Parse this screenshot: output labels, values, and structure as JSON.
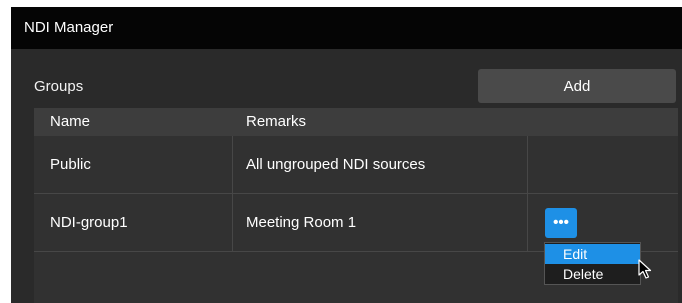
{
  "window": {
    "title": "NDI Manager"
  },
  "groups": {
    "label": "Groups",
    "add_label": "Add",
    "columns": {
      "name": "Name",
      "remarks": "Remarks"
    },
    "rows": [
      {
        "name": "Public",
        "remarks": "All ungrouped NDI sources"
      },
      {
        "name": "NDI-group1",
        "remarks": "Meeting Room 1",
        "actions_label": "•••"
      }
    ]
  },
  "context_menu": {
    "items": [
      {
        "label": "Edit",
        "highlighted": true
      },
      {
        "label": "Delete",
        "highlighted": false
      }
    ]
  },
  "colors": {
    "accent": "#1e90e6",
    "titlebar": "#050505",
    "panel": "#2a2a2a",
    "table_header": "#3d3d3d",
    "button": "#4a4a4a"
  },
  "icons": {
    "more": "more-horizontal-icon",
    "cursor": "mouse-pointer-icon"
  }
}
